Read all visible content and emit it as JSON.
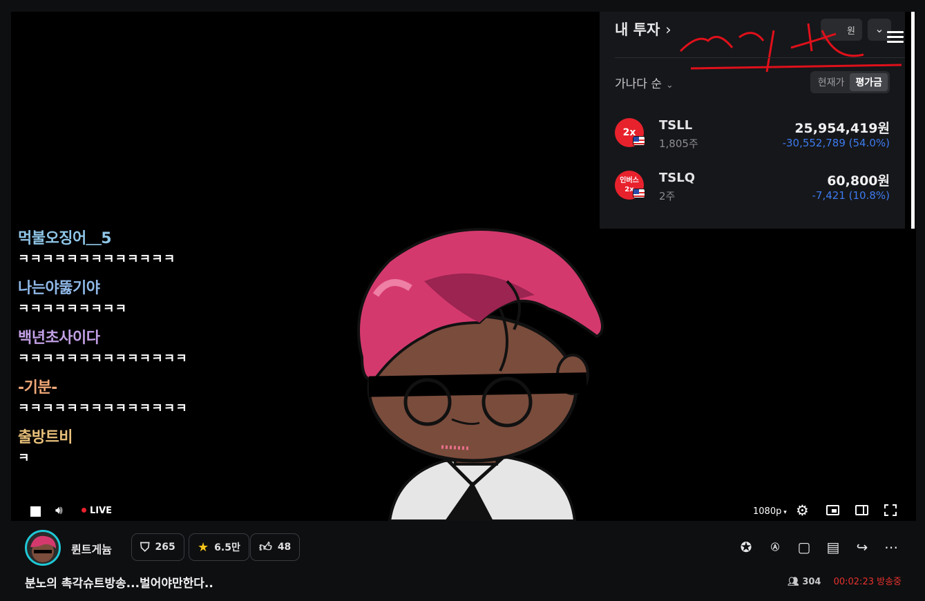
{
  "chat": [
    {
      "user": "먹불오징어＿5",
      "color": "#8fc6e8",
      "text": "ㅋㅋㅋㅋㅋㅋㅋㅋㅋㅋㅋㅋㅋ"
    },
    {
      "user": "나는야뚫기야",
      "color": "#8fb8e8",
      "text": "ㅋㅋㅋㅋㅋㅋㅋㅋㅋ"
    },
    {
      "user": "백년초사이다",
      "color": "#c3a0e6",
      "text": "ㅋㅋㅋㅋㅋㅋㅋㅋㅋㅋㅋㅋㅋㅋ"
    },
    {
      "user": "-기분-",
      "color": "#f0a878",
      "text": "ㅋㅋㅋㅋㅋㅋㅋㅋㅋㅋㅋㅋㅋㅋ"
    },
    {
      "user": "출방트비",
      "color": "#e8c07a",
      "text": "ㅋ"
    }
  ],
  "invest": {
    "title": "내 투자",
    "title_chevron": "›",
    "currency": "원",
    "sort_label": "가나다 순",
    "segment": [
      "현재가",
      "평가금"
    ],
    "holdings": [
      {
        "logo": "2x",
        "symbol": "TSLL",
        "qty": "1,805주",
        "value": "25,954,419원",
        "change": "-30,552,789 (54.0%)"
      },
      {
        "logo": "인버스 2x",
        "symbol": "TSLQ",
        "qty": "2주",
        "value": "60,800원",
        "change": "-7,421 (10.8%)"
      }
    ]
  },
  "player": {
    "live_label": "LIVE",
    "quality": "1080p"
  },
  "info": {
    "channel_name": "륀트게늄",
    "pills": [
      {
        "icon": "cheese-icon",
        "value": "265"
      },
      {
        "icon": "star-icon",
        "value": "6.5만"
      },
      {
        "icon": "thumbs-up-icon",
        "value": "48"
      }
    ],
    "stream_title": "분노의 촉각슈트방송...벌어야만한다..",
    "viewers": "304",
    "elapsed": "00:02:23 방송중"
  }
}
